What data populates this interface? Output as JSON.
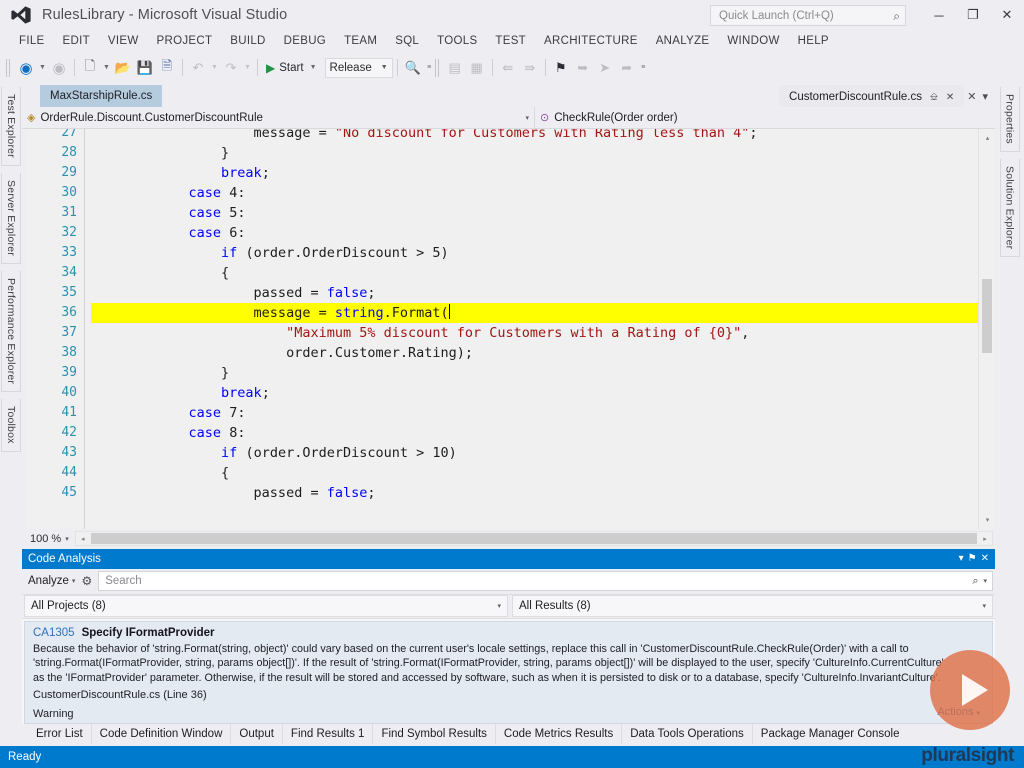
{
  "window": {
    "title": "RulesLibrary - Microsoft Visual Studio",
    "logo_icon": "visual-studio-logo",
    "minimize_icon": "─",
    "restore_icon": "❐",
    "close_icon": "✕"
  },
  "quick_launch": {
    "placeholder": "Quick Launch (Ctrl+Q)",
    "icon": "search-icon",
    "icon_glyph": "⌕"
  },
  "menu": {
    "items": [
      "FILE",
      "EDIT",
      "VIEW",
      "PROJECT",
      "BUILD",
      "DEBUG",
      "TEAM",
      "SQL",
      "TOOLS",
      "TEST",
      "ARCHITECTURE",
      "ANALYZE",
      "WINDOW",
      "HELP"
    ]
  },
  "toolbar": {
    "navigate_back_icon": "←",
    "navigate_forward_icon": "→",
    "new_project_icon": "❐",
    "open_file_icon": "▤",
    "save_icon": "▥",
    "save_all_icon": "▦",
    "undo_icon": "↶",
    "redo_icon": "↷",
    "start_label": "Start",
    "start_play_icon": "▶",
    "configuration": "Release",
    "find_icon": "⌕",
    "step_icons": [
      "⮌",
      "⮍",
      "⮎",
      "⮏"
    ],
    "bookmark_icon": "⚑"
  },
  "left_rail": {
    "items": [
      "Test Explorer",
      "Server Explorer",
      "Performance Explorer",
      "Toolbox"
    ]
  },
  "right_rail": {
    "items": [
      "Properties",
      "Solution Explorer"
    ]
  },
  "document_tabs": {
    "inactive": {
      "label": "MaxStarshipRule.cs"
    },
    "active": {
      "label": "CustomerDiscountRule.cs",
      "pin_icon": "➡",
      "close_icon": "✕"
    },
    "tablist_close_icon": "✕",
    "tablist_menu_icon": "▾"
  },
  "nav_bar": {
    "type_glyph": "◈",
    "type": "OrderRule.Discount.CustomerDiscountRule",
    "member_glyph": "⊙",
    "member": "CheckRule(Order order)",
    "dropdown_arrow": "▾"
  },
  "editor": {
    "zoom": "100 %",
    "zoom_arrow": "▾",
    "scroll_left_arrow": "◂",
    "scroll_right_arrow": "▸",
    "scroll_up_arrow": "▴",
    "scroll_down_arrow": "▾",
    "highlighted_line": 36,
    "lines": [
      {
        "n": 27,
        "partial": true,
        "tokens": [
          {
            "t": "                    message = ",
            "c": "pln"
          },
          {
            "t": "\"No discount for Customers with Rating less than 4\"",
            "c": "str"
          },
          {
            "t": ";",
            "c": "pln"
          }
        ]
      },
      {
        "n": 28,
        "tokens": [
          {
            "t": "                }",
            "c": "pln"
          }
        ]
      },
      {
        "n": 29,
        "tokens": [
          {
            "t": "                ",
            "c": "pln"
          },
          {
            "t": "break",
            "c": "kw"
          },
          {
            "t": ";",
            "c": "pln"
          }
        ]
      },
      {
        "n": 30,
        "tokens": [
          {
            "t": "            ",
            "c": "pln"
          },
          {
            "t": "case",
            "c": "kw"
          },
          {
            "t": " 4:",
            "c": "pln"
          }
        ]
      },
      {
        "n": 31,
        "tokens": [
          {
            "t": "            ",
            "c": "pln"
          },
          {
            "t": "case",
            "c": "kw"
          },
          {
            "t": " 5:",
            "c": "pln"
          }
        ]
      },
      {
        "n": 32,
        "tokens": [
          {
            "t": "            ",
            "c": "pln"
          },
          {
            "t": "case",
            "c": "kw"
          },
          {
            "t": " 6:",
            "c": "pln"
          }
        ]
      },
      {
        "n": 33,
        "tokens": [
          {
            "t": "                ",
            "c": "pln"
          },
          {
            "t": "if",
            "c": "kw"
          },
          {
            "t": " (order.OrderDiscount > 5)",
            "c": "pln"
          }
        ]
      },
      {
        "n": 34,
        "tokens": [
          {
            "t": "                {",
            "c": "pln"
          }
        ]
      },
      {
        "n": 35,
        "tokens": [
          {
            "t": "                    passed = ",
            "c": "pln"
          },
          {
            "t": "false",
            "c": "kw"
          },
          {
            "t": ";",
            "c": "pln"
          }
        ]
      },
      {
        "n": 36,
        "highlight": true,
        "tokens": [
          {
            "t": "                    message = ",
            "c": "pln"
          },
          {
            "t": "string",
            "c": "kw"
          },
          {
            "t": ".Format(",
            "c": "pln"
          }
        ]
      },
      {
        "n": 37,
        "tokens": [
          {
            "t": "                        ",
            "c": "pln"
          },
          {
            "t": "\"Maximum 5% discount for Customers with a Rating of {0}\"",
            "c": "str"
          },
          {
            "t": ",",
            "c": "pln"
          }
        ]
      },
      {
        "n": 38,
        "tokens": [
          {
            "t": "                        order.Customer.Rating);",
            "c": "pln"
          }
        ]
      },
      {
        "n": 39,
        "tokens": [
          {
            "t": "                }",
            "c": "pln"
          }
        ]
      },
      {
        "n": 40,
        "tokens": [
          {
            "t": "                ",
            "c": "pln"
          },
          {
            "t": "break",
            "c": "kw"
          },
          {
            "t": ";",
            "c": "pln"
          }
        ]
      },
      {
        "n": 41,
        "tokens": [
          {
            "t": "            ",
            "c": "pln"
          },
          {
            "t": "case",
            "c": "kw"
          },
          {
            "t": " 7:",
            "c": "pln"
          }
        ]
      },
      {
        "n": 42,
        "tokens": [
          {
            "t": "            ",
            "c": "pln"
          },
          {
            "t": "case",
            "c": "kw"
          },
          {
            "t": " 8:",
            "c": "pln"
          }
        ]
      },
      {
        "n": 43,
        "tokens": [
          {
            "t": "                ",
            "c": "pln"
          },
          {
            "t": "if",
            "c": "kw"
          },
          {
            "t": " (order.OrderDiscount > 10)",
            "c": "pln"
          }
        ]
      },
      {
        "n": 44,
        "tokens": [
          {
            "t": "                {",
            "c": "pln"
          }
        ]
      },
      {
        "n": 45,
        "partial": true,
        "tokens": [
          {
            "t": "                    passed = ",
            "c": "pln"
          },
          {
            "t": "false",
            "c": "kw"
          },
          {
            "t": ";",
            "c": "pln"
          }
        ]
      }
    ]
  },
  "code_analysis": {
    "title": "Code Analysis",
    "dropdown_icon": "▾",
    "pin_icon": "⚑",
    "close_icon": "✕",
    "analyze_label": "Analyze",
    "analyze_arrow": "▾",
    "gear_icon": "⚙",
    "search_placeholder": "Search",
    "search_icon": "⌕",
    "search_arrow": "▾",
    "filter_projects": "All Projects (8)",
    "filter_results": "All Results (8)",
    "filter_arrow": "▾",
    "actions_label": "Actions",
    "actions_arrow": "▾",
    "items": [
      {
        "code": "CA1305",
        "name": "Specify IFormatProvider",
        "description": "Because the behavior of 'string.Format(string, object)' could vary based on the current user's locale settings, replace this call in 'CustomerDiscountRule.CheckRule(Order)' with a call to 'string.Format(IFormatProvider, string, params object[])'. If the result of 'string.Format(IFormatProvider, string, params object[])' will be displayed to the user, specify 'CultureInfo.CurrentCulture' as the 'IFormatProvider' parameter. Otherwise, if the result will be stored and accessed by software, such as when it is persisted to disk or to a database, specify 'CultureInfo.InvariantCulture'.",
        "file": "CustomerDiscountRule.cs (Line 36)",
        "severity": "Warning"
      }
    ]
  },
  "bottom_tabs": {
    "items": [
      "Error List",
      "Code Definition Window",
      "Output",
      "Find Results 1",
      "Find Symbol Results",
      "Code Metrics Results",
      "Data Tools Operations",
      "Package Manager Console"
    ]
  },
  "status_bar": {
    "text": "Ready"
  },
  "overlay": {
    "play_icon": "play-button",
    "brand": "pluralsight"
  },
  "colors": {
    "accent_blue": "#007acc",
    "title_bar": "#eeeef2",
    "highlight_yellow": "#ffff00",
    "keyword_blue": "#0000ff",
    "string_red": "#a31515",
    "type_teal": "#2b91af",
    "tab_inactive": "#b5ccdf"
  }
}
